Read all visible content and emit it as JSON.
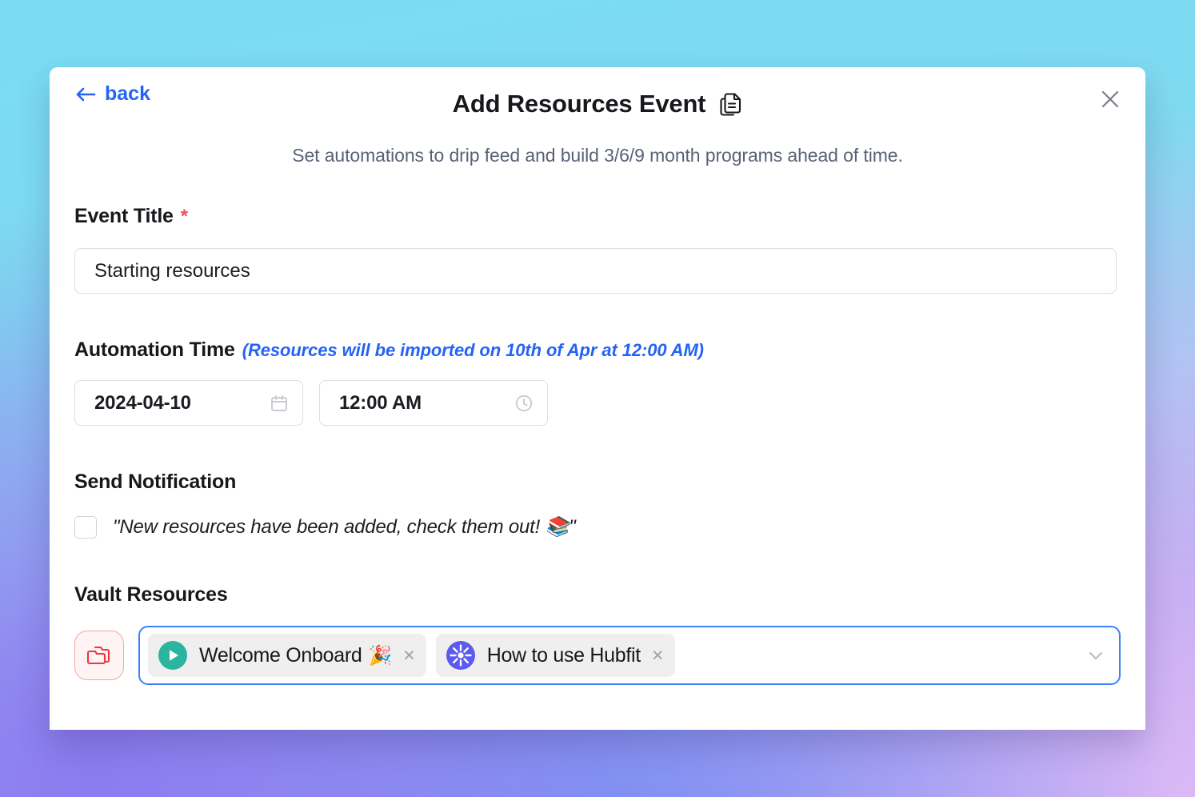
{
  "header": {
    "back_label": "back",
    "back_icon": "arrow-left-icon",
    "title": "Add Resources Event",
    "title_icon": "documents-copy-icon",
    "close_icon": "close-icon",
    "subtitle": "Set automations to drip feed and build 3/6/9 month programs ahead of time."
  },
  "theme": {
    "accent_blue": "#2563f6",
    "focus_border": "#3b82f6",
    "required_red": "#e8535f",
    "folder_red": "#f5333f",
    "play_teal": "#2bb5a0",
    "burst_indigo": "#5b5bf0",
    "subtitle_gray": "#5a6277"
  },
  "event_title": {
    "label": "Event Title",
    "required_marker": "*",
    "value": "Starting resources",
    "placeholder": "Event title"
  },
  "automation_time": {
    "label": "Automation Time",
    "hint": "(Resources will be imported on 10th of Apr at 12:00 AM)",
    "date": {
      "value": "2024-04-10",
      "placeholder": "YYYY-MM-DD",
      "icon": "calendar-icon"
    },
    "time": {
      "value": "12:00 AM",
      "placeholder": "hh:mm AM",
      "icon": "clock-icon"
    }
  },
  "send_notification": {
    "label": "Send Notification",
    "checked": false,
    "message": "\"New resources have been added, check them out! 📚\""
  },
  "vault_resources": {
    "label": "Vault Resources",
    "folder_button_icon": "folders-icon",
    "dropdown_icon": "chevron-down-icon",
    "selected": [
      {
        "label": "Welcome Onboard",
        "emoji": "🎉",
        "icon": "play-circle-icon",
        "remove_label": "×"
      },
      {
        "label": "How to use Hubfit",
        "emoji": "",
        "icon": "burst-circle-icon",
        "remove_label": "×"
      }
    ]
  }
}
